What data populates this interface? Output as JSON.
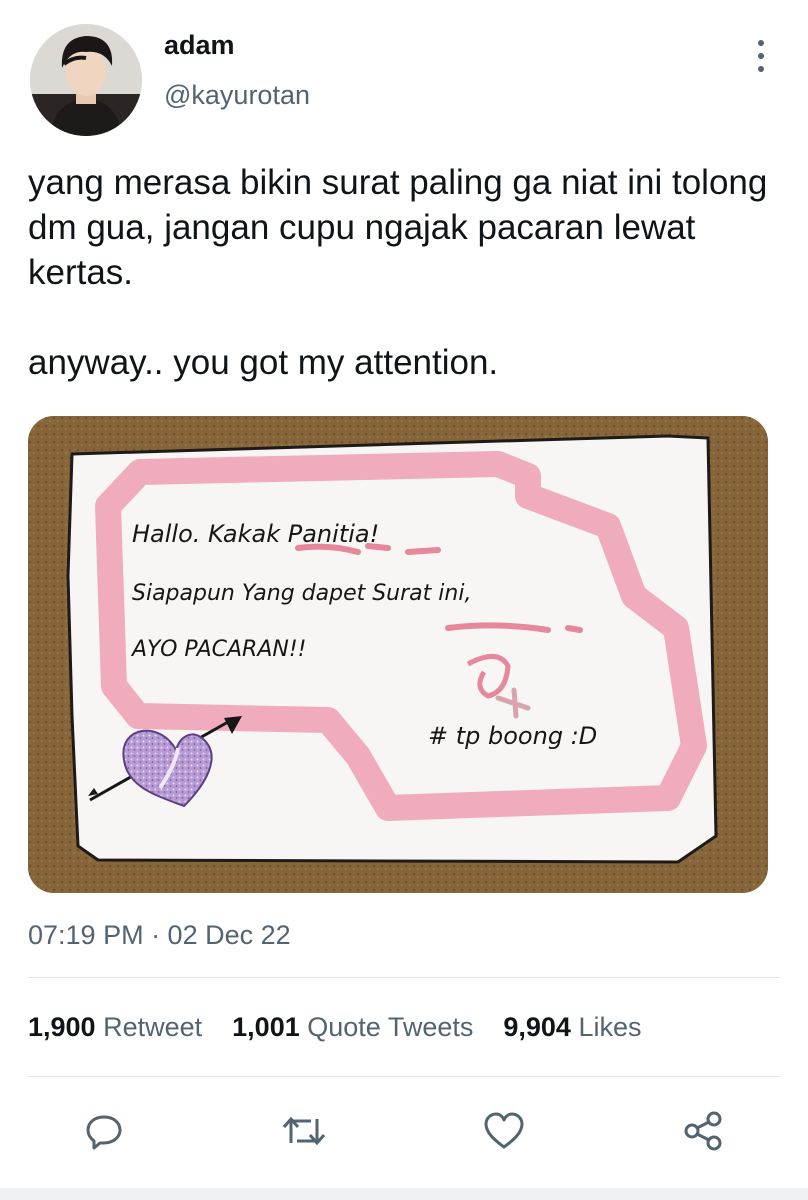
{
  "author": {
    "name": "adam",
    "handle": "@kayurotan"
  },
  "tweet": {
    "paragraphs": [
      "yang merasa bikin surat paling ga niat ini tolong dm gua, jangan cupu ngajak pacaran lewat kertas.",
      "anyway.. you got my attention."
    ],
    "timestamp": "07:19 PM · 02 Dec 22"
  },
  "photo": {
    "note_lines": [
      "Hallo. Kakak Panitia!",
      "Siapapun Yang dapet Surat ini,",
      "AYO PACARAN!!",
      "# tp boong :D"
    ]
  },
  "stats": {
    "retweets": {
      "count": "1,900",
      "label": "Retweet"
    },
    "quotes": {
      "count": "1,001",
      "label": "Quote Tweets"
    },
    "likes": {
      "count": "9,904",
      "label": "Likes"
    }
  },
  "icons": [
    "more-vertical-icon",
    "reply-icon",
    "retweet-icon",
    "like-icon",
    "share-icon"
  ],
  "colors": {
    "secondary_text": "#536471",
    "primary_text": "#0f1419",
    "divider": "#e1e4e8"
  }
}
